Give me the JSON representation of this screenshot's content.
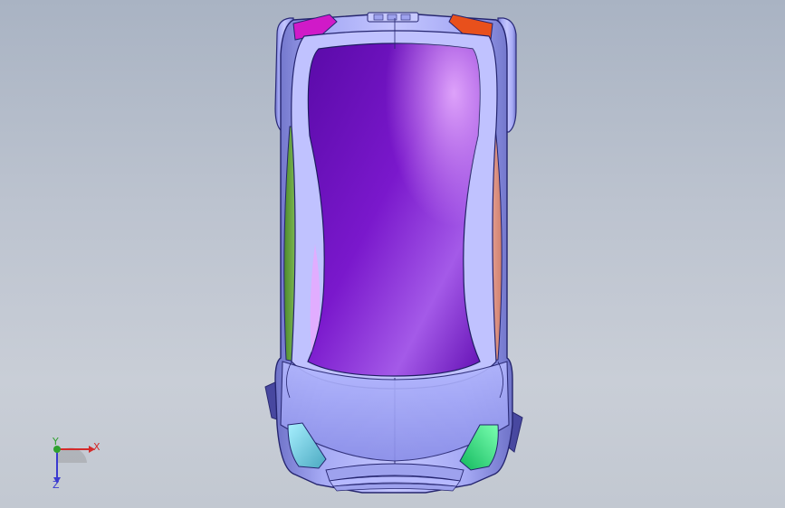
{
  "viewport": {
    "background_top": "#a9b3c3",
    "background_bottom": "#c9ced7",
    "model": {
      "body_color": "#9a9ff0",
      "cabin_color": "#7414c4",
      "accent_left_rear": "#d01ac8",
      "accent_right_rear": "#e8501c",
      "accent_left_side": "#6aa83a",
      "accent_right_side": "#e79a8e",
      "accent_left_front": "#6ac6d8",
      "accent_right_front": "#22d878"
    },
    "triad": {
      "x_label": "X",
      "y_label": "Y",
      "z_label": "Z",
      "x_color": "#d42a2a",
      "y_color": "#2ea12e",
      "z_color": "#3a3ad0"
    }
  }
}
